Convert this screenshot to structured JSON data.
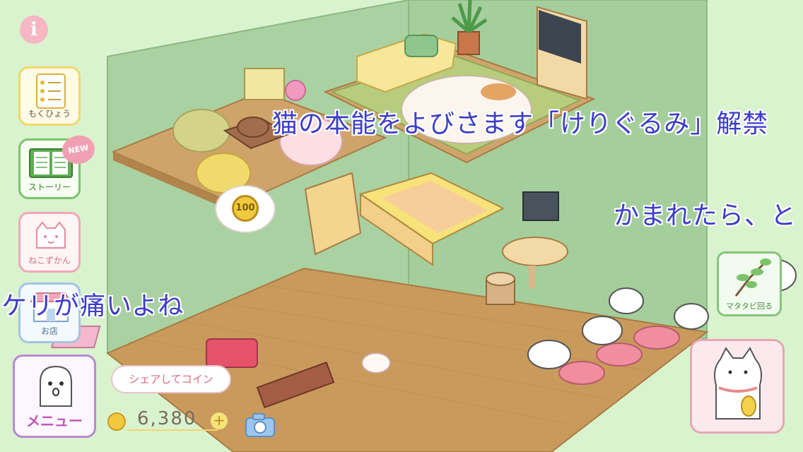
{
  "sidebar": {
    "info_label": "i",
    "goals_label": "もくひょう",
    "story_label": "ストーリー",
    "story_badge": "NEW",
    "catdex_label": "ねこずかん",
    "shop_label": "お店",
    "menu_label": "メニュー"
  },
  "tickers": {
    "line1": "猫の本能をよびさます「けりぐるみ」解禁",
    "line2": "かまれたら、と",
    "line3": "ケリが痛いよね"
  },
  "bubble": {
    "coin_value": "100"
  },
  "share": {
    "label": "シェアしてコイン"
  },
  "coins": {
    "amount": "6,380",
    "plus": "+"
  },
  "matatabi": {
    "label": "マタタビ回る"
  },
  "colors": {
    "background": "#d9f3cf",
    "wall": "#aad2a2",
    "floor": "#c99a5c",
    "ticker_text": "#3c3ec9",
    "goals_border": "#f0d86a",
    "story_border": "#7cc36c",
    "catdex_border": "#f2a7b8",
    "shop_border": "#a3c5e3",
    "menu_border": "#b88ad0"
  }
}
